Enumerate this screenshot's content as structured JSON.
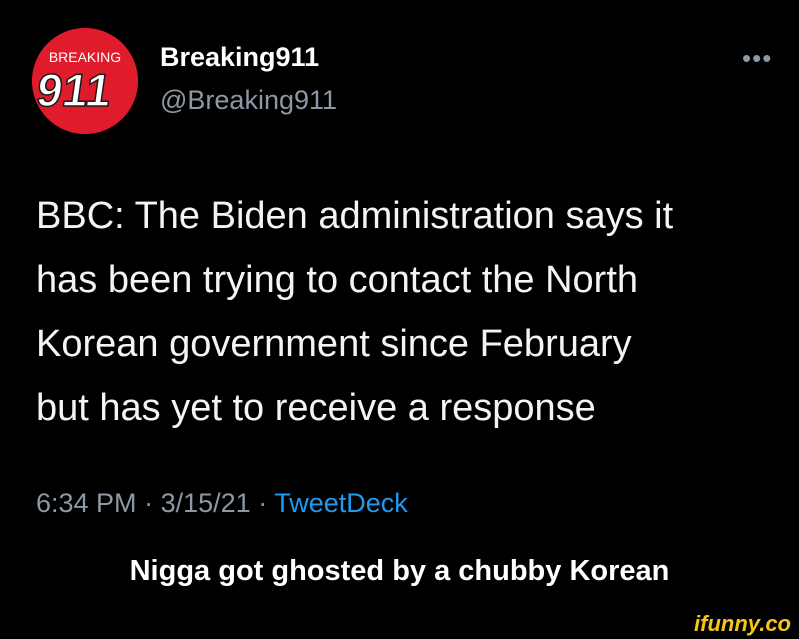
{
  "tweet": {
    "avatar_text": {
      "top": "BREAKING",
      "number": "911"
    },
    "display_name": "Breaking911",
    "handle": "@Breaking911",
    "more_icon": "more-horizontal-icon",
    "lines": [
      "BBC: The Biden administration says it",
      "has been trying to contact the North",
      "Korean government since February",
      "but has yet to receive a response"
    ],
    "time": "6:34 PM",
    "separator": "·",
    "date": "3/15/21",
    "source": "TweetDeck"
  },
  "caption": "Nigga got ghosted by a chubby Korean",
  "watermark": "ifunny.co",
  "colors": {
    "background": "#000000",
    "avatar_red": "#e01b2c",
    "link_blue": "#1d9bf0",
    "muted": "#8b98a5",
    "watermark_yellow": "#f5c518"
  }
}
